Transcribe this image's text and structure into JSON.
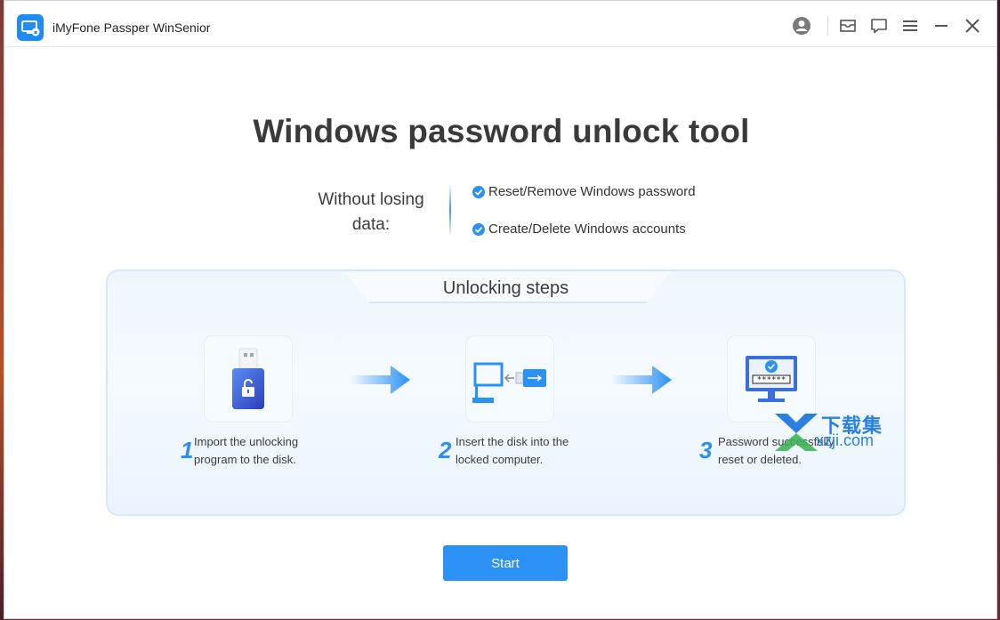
{
  "window": {
    "title": "iMyFone Passper WinSenior"
  },
  "titlebar": {
    "icons": [
      "account-icon",
      "mail-icon",
      "feedback-icon",
      "menu-icon",
      "minimize-icon",
      "close-icon"
    ]
  },
  "main": {
    "heading": "Windows password unlock tool",
    "without_label": "Without losing data:",
    "features": [
      "Reset/Remove Windows password",
      "Create/Delete Windows accounts"
    ]
  },
  "steps": {
    "title": "Unlocking steps",
    "items": [
      {
        "num": "1",
        "line1": "Import the unlocking",
        "line2": "program to the disk.",
        "icon": "usb-lock-icon"
      },
      {
        "num": "2",
        "line1": "Insert the disk into the",
        "line2": "locked computer.",
        "icon": "computer-usb-icon"
      },
      {
        "num": "3",
        "line1": "Password successfully",
        "line2": "reset or deleted.",
        "icon": "monitor-password-icon"
      }
    ]
  },
  "start_label": "Start",
  "watermark": {
    "title": "下载集",
    "url": "xzji.com"
  },
  "colors": {
    "accent": "#2b91f5",
    "heading": "#3a3a3a",
    "panel_border": "#d5e9fb"
  }
}
